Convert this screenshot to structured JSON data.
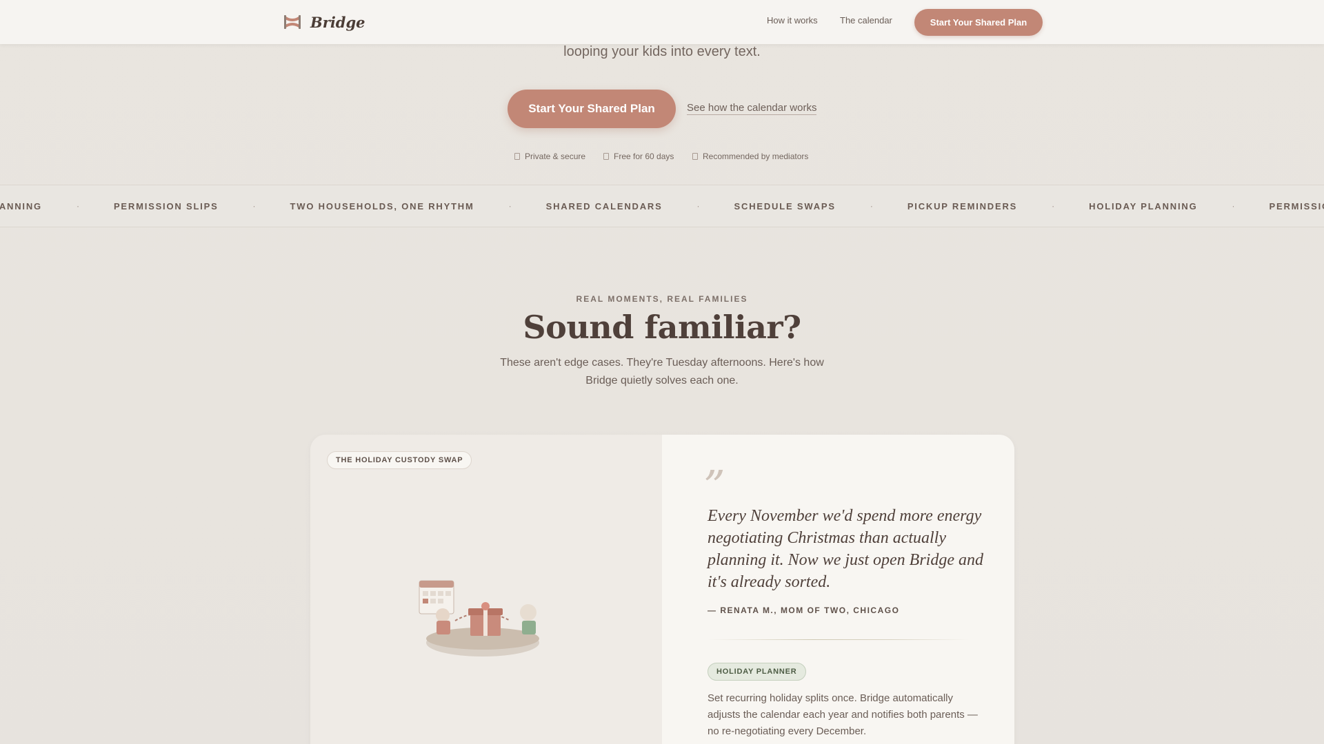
{
  "header": {
    "brand": "Bridge",
    "nav": {
      "how_it_works": "How it works",
      "calendar": "The calendar"
    },
    "cta": "Start Your Shared Plan"
  },
  "hero": {
    "subtitle_tail": "looping your kids into every text.",
    "primary_cta": "Start Your Shared Plan",
    "secondary_link": "See how the calendar works",
    "trust": [
      "Private & secure",
      "Free for 60 days",
      "Recommended by mediators"
    ]
  },
  "marquee": {
    "items": [
      "Y PLANNING",
      "PERMISSION SLIPS",
      "TWO HOUSEHOLDS, ONE RHYTHM",
      "SHARED CALENDARS",
      "SCHEDULE SWAPS",
      "PICKUP REMINDERS",
      "HOLIDAY PLANNING",
      "PERMISSIO"
    ],
    "separator": "·"
  },
  "section": {
    "eyebrow": "REAL MOMENTS, REAL FAMILIES",
    "title": "Sound familiar?",
    "description": "These aren't edge cases. They're Tuesday afternoons. Here's how Bridge quietly solves each one."
  },
  "story": {
    "scenario": "THE HOLIDAY CUSTODY SWAP",
    "quote_mark": "”",
    "quote": "Every November we'd spend more energy negotiating Christmas than actually planning it. Now we just open Bridge and it's already sorted.",
    "author": "— RENATA M., MOM OF TWO, CHICAGO",
    "feature": "HOLIDAY PLANNER",
    "feature_description": "Set recurring holiday splits once. Bridge automatically adjusts the calendar each year and notifies both parents — no re-negotiating every December."
  },
  "colors": {
    "accent": "#c28776",
    "page_bg": "#e9e5df",
    "heading": "#4f403a",
    "feature_green": "#4d5c44"
  }
}
